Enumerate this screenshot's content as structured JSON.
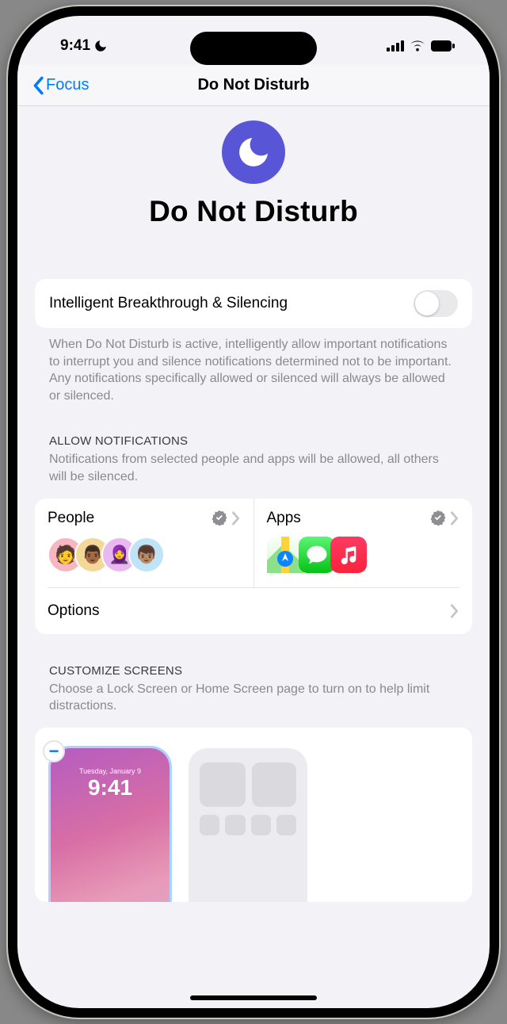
{
  "status": {
    "time": "9:41"
  },
  "nav": {
    "back_label": "Focus",
    "title": "Do Not Disturb"
  },
  "hero": {
    "title": "Do Not Disturb"
  },
  "intelligent": {
    "label": "Intelligent Breakthrough & Silencing",
    "footnote": "When Do Not Disturb is active, intelligently allow important notifications to interrupt you and silence notifications determined not to be important. Any notifications specifically allowed or silenced will always be allowed or silenced.",
    "enabled": false
  },
  "allow": {
    "header": "ALLOW NOTIFICATIONS",
    "sub": "Notifications from selected people and apps will be allowed, all others will be silenced.",
    "people_label": "People",
    "apps_label": "Apps",
    "options_label": "Options",
    "people_avatars": [
      {
        "bg": "#f7b6c2"
      },
      {
        "bg": "#f3d89a"
      },
      {
        "bg": "#e9b8f0"
      },
      {
        "bg": "#bfe3f7"
      }
    ],
    "apps_icons": [
      {
        "name": "maps"
      },
      {
        "name": "messages"
      },
      {
        "name": "music"
      }
    ]
  },
  "customize": {
    "header": "CUSTOMIZE SCREENS",
    "sub": "Choose a Lock Screen or Home Screen page to turn on to help limit distractions.",
    "lock_date": "Tuesday, January 9",
    "lock_time": "9:41"
  }
}
